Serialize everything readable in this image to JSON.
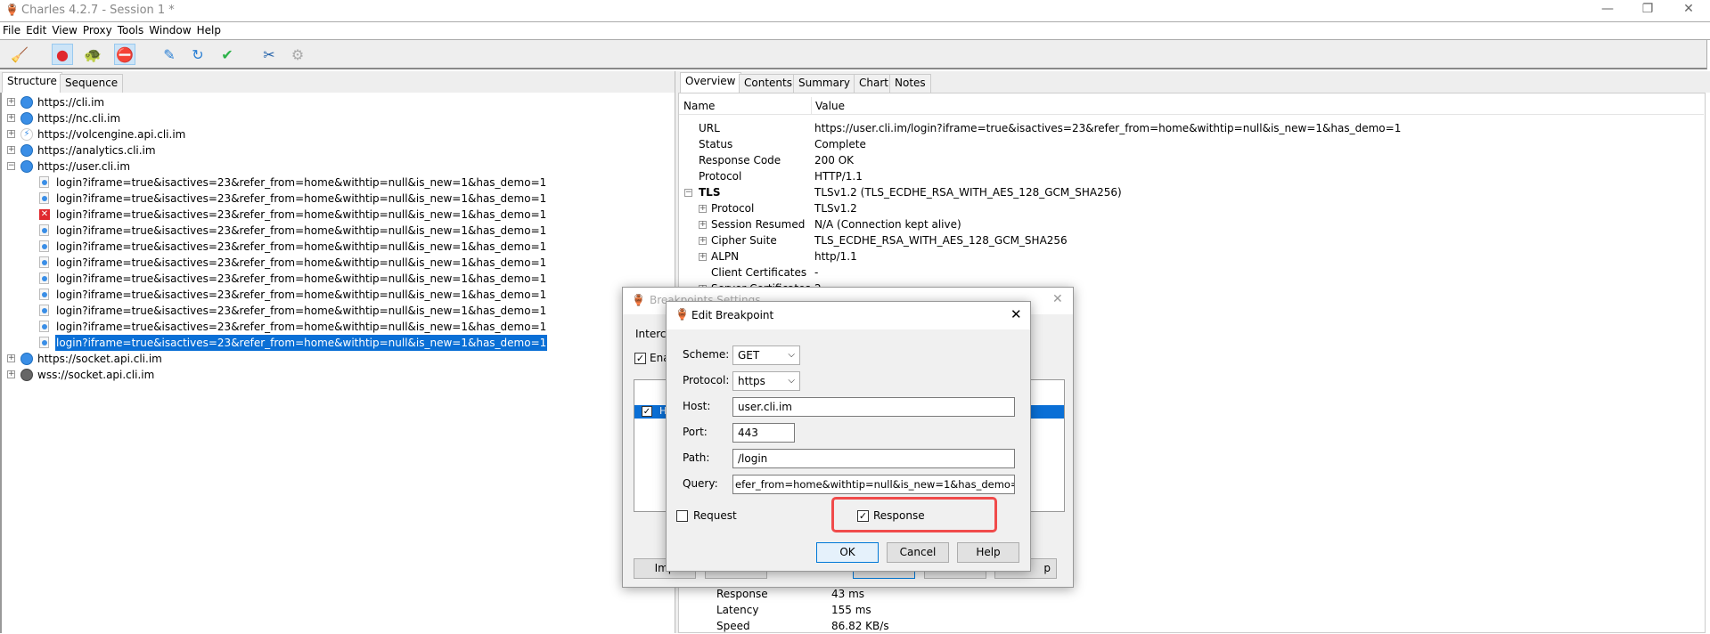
{
  "window": {
    "title": "Charles 4.2.7 - Session 1 *",
    "minimize": "—",
    "restore": "❐",
    "close": "✕"
  },
  "menu": [
    "File",
    "Edit",
    "View",
    "Proxy",
    "Tools",
    "Window",
    "Help"
  ],
  "toolbar": [
    {
      "icon": "broom-icon",
      "glyph": "🧹",
      "active": false
    },
    {
      "icon": "record-icon",
      "glyph": "●",
      "active": true
    },
    {
      "icon": "throttle-turtle-icon",
      "glyph": "🐢",
      "active": false
    },
    {
      "icon": "breakpoint-stop-icon",
      "glyph": "⛔",
      "active": true
    },
    {
      "icon": "compose-pen-icon",
      "glyph": "✎",
      "active": false
    },
    {
      "icon": "repeat-icon",
      "glyph": "↻",
      "active": false
    },
    {
      "icon": "validate-check-icon",
      "glyph": "✔",
      "active": false
    },
    {
      "icon": "tools-icon",
      "glyph": "✂",
      "active": false
    },
    {
      "icon": "settings-gear-icon",
      "glyph": "⚙",
      "active": false
    }
  ],
  "left_tabs": [
    "Structure",
    "Sequence"
  ],
  "tree": {
    "hosts_before": [
      {
        "label": "https://cli.im",
        "icon": "globe-icon"
      },
      {
        "label": "https://nc.cli.im",
        "icon": "globe-icon"
      },
      {
        "label": "https://volcengine.api.cli.im",
        "icon": "lightning-icon"
      },
      {
        "label": "https://analytics.cli.im",
        "icon": "globe-icon"
      },
      {
        "label": "https://user.cli.im",
        "icon": "globe-icon",
        "expanded": true
      }
    ],
    "requests": [
      {
        "label": "login?iframe=true&isactives=23&refer_from=home&withtip=null&is_new=1&has_demo=1",
        "status": "ok"
      },
      {
        "label": "login?iframe=true&isactives=23&refer_from=home&withtip=null&is_new=1&has_demo=1",
        "status": "ok"
      },
      {
        "label": "login?iframe=true&isactives=23&refer_from=home&withtip=null&is_new=1&has_demo=1",
        "status": "error"
      },
      {
        "label": "login?iframe=true&isactives=23&refer_from=home&withtip=null&is_new=1&has_demo=1",
        "status": "ok"
      },
      {
        "label": "login?iframe=true&isactives=23&refer_from=home&withtip=null&is_new=1&has_demo=1",
        "status": "ok"
      },
      {
        "label": "login?iframe=true&isactives=23&refer_from=home&withtip=null&is_new=1&has_demo=1",
        "status": "ok"
      },
      {
        "label": "login?iframe=true&isactives=23&refer_from=home&withtip=null&is_new=1&has_demo=1",
        "status": "ok"
      },
      {
        "label": "login?iframe=true&isactives=23&refer_from=home&withtip=null&is_new=1&has_demo=1",
        "status": "ok"
      },
      {
        "label": "login?iframe=true&isactives=23&refer_from=home&withtip=null&is_new=1&has_demo=1",
        "status": "ok"
      },
      {
        "label": "login?iframe=true&isactives=23&refer_from=home&withtip=null&is_new=1&has_demo=1",
        "status": "ok"
      },
      {
        "label": "login?iframe=true&isactives=23&refer_from=home&withtip=null&is_new=1&has_demo=1",
        "status": "ok",
        "selected": true
      }
    ],
    "hosts_after": [
      {
        "label": "https://socket.api.cli.im",
        "icon": "globe-icon"
      },
      {
        "label": "wss://socket.api.cli.im",
        "icon": "websocket-icon"
      }
    ]
  },
  "right_tabs": [
    "Overview",
    "Contents",
    "Summary",
    "Chart",
    "Notes"
  ],
  "overview": {
    "col_name": "Name",
    "col_value": "Value",
    "rows": [
      {
        "name": "URL",
        "value": "https://user.cli.im/login?iframe=true&isactives=23&refer_from=home&withtip=null&is_new=1&has_demo=1",
        "level": 1
      },
      {
        "name": "Status",
        "value": "Complete",
        "level": 1
      },
      {
        "name": "Response Code",
        "value": "200 OK",
        "level": 1
      },
      {
        "name": "Protocol",
        "value": "HTTP/1.1",
        "level": 1
      },
      {
        "name": "TLS",
        "value": "TLSv1.2 (TLS_ECDHE_RSA_WITH_AES_128_GCM_SHA256)",
        "level": 0,
        "toggle": "−",
        "bold": true
      },
      {
        "name": "Protocol",
        "value": "TLSv1.2",
        "level": 2,
        "toggle": "+"
      },
      {
        "name": "Session Resumed",
        "value": "N/A (Connection kept alive)",
        "level": 2,
        "toggle": "+"
      },
      {
        "name": "Cipher Suite",
        "value": "TLS_ECDHE_RSA_WITH_AES_128_GCM_SHA256",
        "level": 2,
        "toggle": "+"
      },
      {
        "name": "ALPN",
        "value": "http/1.1",
        "level": 2,
        "toggle": "+"
      },
      {
        "name": "Client Certificates",
        "value": "-",
        "level": 2
      },
      {
        "name": "Server Certificates",
        "value": "2",
        "level": 2,
        "toggle": "+"
      }
    ],
    "bottom_rows": [
      {
        "name": "Response",
        "value": "43 ms"
      },
      {
        "name": "Latency",
        "value": "155 ms"
      },
      {
        "name": "Speed",
        "value": "86.82 KB/s"
      }
    ]
  },
  "breakpoints_settings": {
    "title": "Breakpoints Settings",
    "intercept_label": "Interce",
    "enable_label": "Ena",
    "enable_checked": true,
    "row_label": "H",
    "import_label": "Imp",
    "tail_label": "p",
    "close": "✕"
  },
  "edit_breakpoint": {
    "title": "Edit Breakpoint",
    "close": "✕",
    "scheme_label": "Scheme:",
    "scheme_value": "GET",
    "protocol_label": "Protocol:",
    "protocol_value": "https",
    "host_label": "Host:",
    "host_value": "user.cli.im",
    "port_label": "Port:",
    "port_value": "443",
    "path_label": "Path:",
    "path_value": "/login",
    "query_label": "Query:",
    "query_value": "efer_from=home&withtip=null&is_new=1&has_demo=1",
    "request_label": "Request",
    "request_checked": false,
    "response_label": "Response",
    "response_checked": true,
    "ok": "OK",
    "cancel": "Cancel",
    "help": "Help",
    "highlight_color": "#f04b4b"
  }
}
